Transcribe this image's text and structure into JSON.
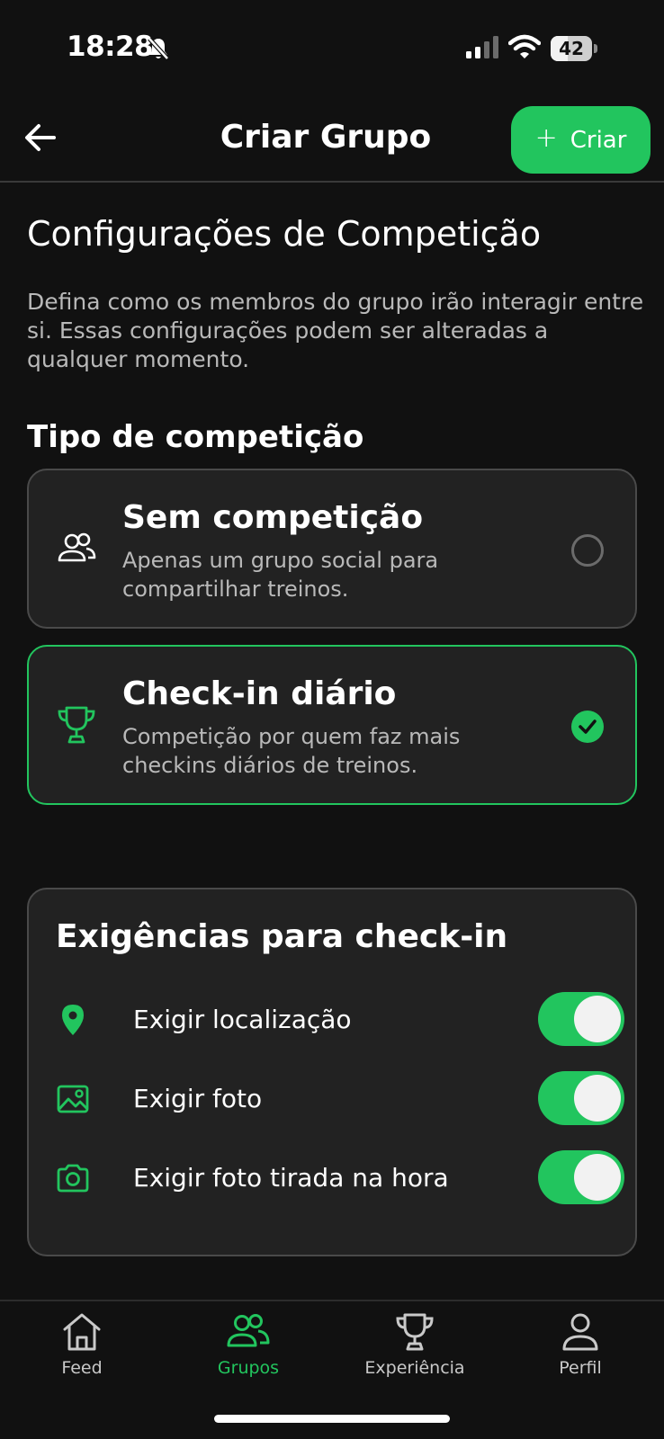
{
  "status_bar": {
    "time": "18:28",
    "battery": "42",
    "battery_level": 0.42
  },
  "header": {
    "title": "Criar Grupo",
    "create_label": "Criar",
    "create_plus": "+"
  },
  "section": {
    "title": "Configurações de Competição",
    "description": "Defina como os membros do grupo irão interagir entre si. Essas configurações podem ser alteradas a qualquer momento."
  },
  "competition": {
    "heading": "Tipo de competição",
    "options": [
      {
        "title": "Sem competição",
        "subtitle": "Apenas um grupo social para compartilhar treinos.",
        "icon": "users-icon",
        "selected": false
      },
      {
        "title": "Check-in diário",
        "subtitle": "Competição por quem faz mais checkins diários de treinos.",
        "icon": "trophy-icon",
        "selected": true
      }
    ]
  },
  "requirements": {
    "title": "Exigências para check-in",
    "items": [
      {
        "label": "Exigir localização",
        "icon": "location-pin-icon",
        "enabled": true
      },
      {
        "label": "Exigir foto",
        "icon": "image-icon",
        "enabled": true
      },
      {
        "label": "Exigir foto tirada na hora",
        "icon": "camera-icon",
        "enabled": true
      }
    ]
  },
  "tabs": [
    {
      "label": "Feed",
      "icon": "home-icon",
      "active": false
    },
    {
      "label": "Grupos",
      "icon": "users-icon",
      "active": true
    },
    {
      "label": "Experiência",
      "icon": "trophy-icon",
      "active": false
    },
    {
      "label": "Perfil",
      "icon": "user-icon",
      "active": false
    }
  ],
  "colors": {
    "background": "#111111",
    "card": "#222222",
    "accent": "#22c55e",
    "muted_text": "#b9b9b9"
  }
}
